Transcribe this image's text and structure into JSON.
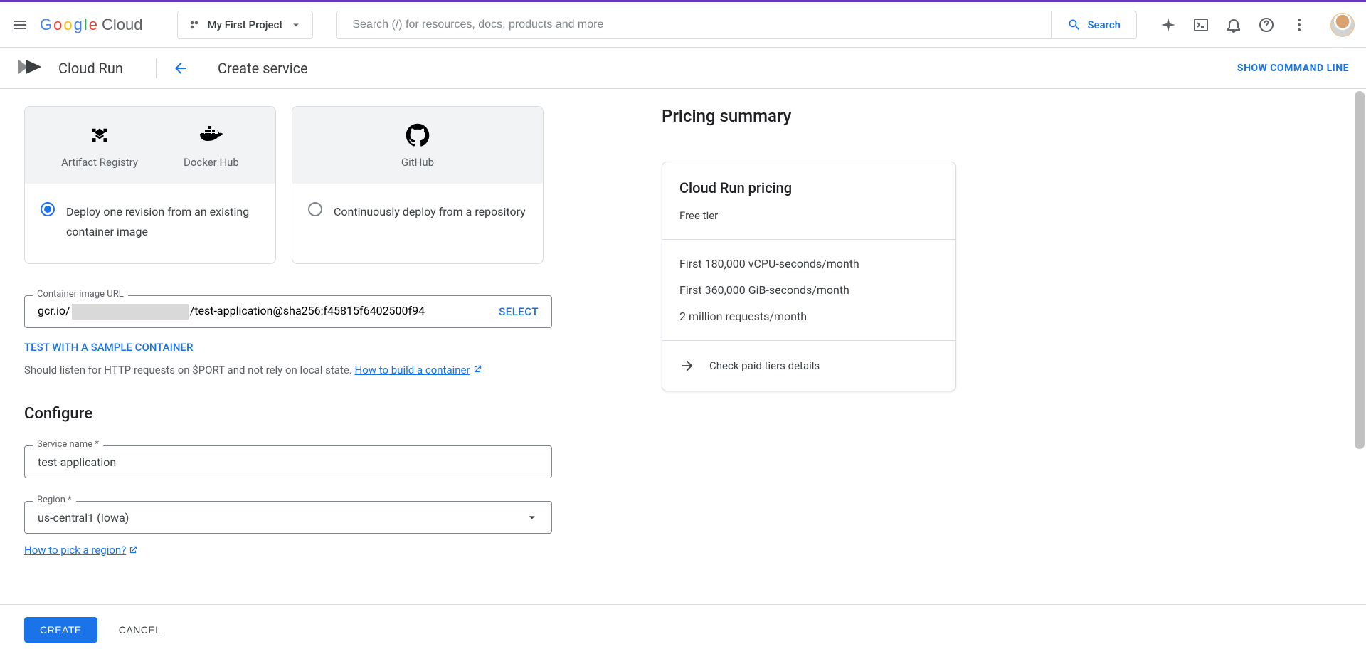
{
  "topbar": {
    "project": "My First Project",
    "search_placeholder": "Search (/) for resources, docs, products and more",
    "search_btn": "Search"
  },
  "product": {
    "name": "Cloud Run",
    "page_title": "Create service",
    "show_cmd": "SHOW COMMAND LINE"
  },
  "option_cards": {
    "src_artifact": "Artifact Registry",
    "src_docker": "Docker Hub",
    "src_github": "GitHub",
    "opt_deploy": "Deploy one revision from an existing container image",
    "opt_continuous": "Continuously deploy from a repository"
  },
  "container_image": {
    "label": "Container image URL",
    "prefix": "gcr.io/",
    "suffix": "/test-application@sha256:f45815f6402500f94",
    "select": "SELECT",
    "test_link": "TEST WITH A SAMPLE CONTAINER",
    "hint_pre": "Should listen for HTTP requests on $PORT and not rely on local state.",
    "hint_link": "How to build a container"
  },
  "configure": {
    "heading": "Configure",
    "service_label": "Service name *",
    "service_value": "test-application",
    "region_label": "Region *",
    "region_value": "us-central1 (Iowa)",
    "region_help": "How to pick a region?"
  },
  "pricing": {
    "title": "Pricing summary",
    "card_title": "Cloud Run pricing",
    "free_tier": "Free tier",
    "rows": {
      "r0": "First 180,000 vCPU-seconds/month",
      "r1": "First 360,000 GiB-seconds/month",
      "r2": "2 million requests/month"
    },
    "details": "Check paid tiers details"
  },
  "footer": {
    "create": "CREATE",
    "cancel": "CANCEL"
  }
}
